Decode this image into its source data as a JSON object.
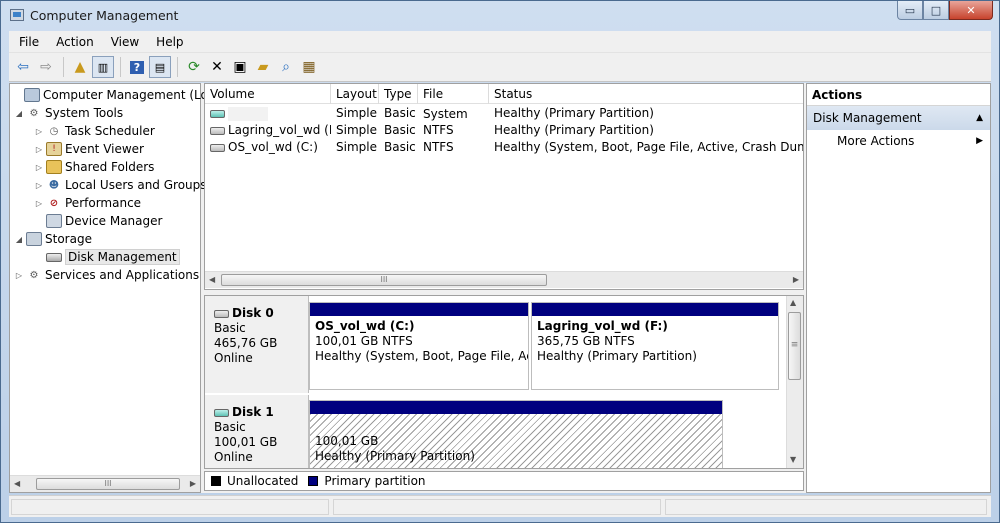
{
  "window": {
    "title": "Computer Management",
    "min": "▭",
    "max": "□",
    "close": "✕"
  },
  "menu": [
    "File",
    "Action",
    "View",
    "Help"
  ],
  "tree": [
    {
      "label": "Computer Management (Local)",
      "level": 0,
      "expander": "",
      "icon": "computer-icon"
    },
    {
      "label": "System Tools",
      "level": 1,
      "expander": "◢",
      "icon": "tools-icon"
    },
    {
      "label": "Task Scheduler",
      "level": 2,
      "expander": "▷",
      "icon": "clock-icon"
    },
    {
      "label": "Event Viewer",
      "level": 2,
      "expander": "▷",
      "icon": "event-viewer-icon"
    },
    {
      "label": "Shared Folders",
      "level": 2,
      "expander": "▷",
      "icon": "shared-folder-icon"
    },
    {
      "label": "Local Users and Groups",
      "level": 2,
      "expander": "▷",
      "icon": "users-icon"
    },
    {
      "label": "Performance",
      "level": 2,
      "expander": "▷",
      "icon": "performance-icon"
    },
    {
      "label": "Device Manager",
      "level": 2,
      "expander": "",
      "icon": "device-manager-icon"
    },
    {
      "label": "Storage",
      "level": 1,
      "expander": "◢",
      "icon": "storage-icon"
    },
    {
      "label": "Disk Management",
      "level": 2,
      "expander": "",
      "icon": "disk-management-icon"
    },
    {
      "label": "Services and Applications",
      "level": 1,
      "expander": "▷",
      "icon": "services-icon"
    }
  ],
  "volumes": {
    "headers": [
      "Volume",
      "Layout",
      "Type",
      "File System",
      "Status"
    ],
    "rows": [
      {
        "volume": "",
        "layout": "Simple",
        "type": "Basic",
        "fs": "",
        "status": "Healthy (Primary Partition)"
      },
      {
        "volume": "Lagring_vol_wd (F:)",
        "layout": "Simple",
        "type": "Basic",
        "fs": "NTFS",
        "status": "Healthy (Primary Partition)"
      },
      {
        "volume": "OS_vol_wd (C:)",
        "layout": "Simple",
        "type": "Basic",
        "fs": "NTFS",
        "status": "Healthy (System, Boot, Page File, Active, Crash Dump, Primary Partition)"
      }
    ]
  },
  "disks": [
    {
      "name": "Disk 0",
      "type": "Basic",
      "size": "465,76 GB",
      "state": "Online",
      "partitions": [
        {
          "name": "OS_vol_wd  (C:)",
          "size": "100,01 GB NTFS",
          "status": "Healthy (System, Boot, Page File, Active"
        },
        {
          "name": "Lagring_vol_wd  (F:)",
          "size": "365,75 GB NTFS",
          "status": "Healthy (Primary Partition)"
        }
      ]
    },
    {
      "name": "Disk 1",
      "type": "Basic",
      "size": "100,01 GB",
      "state": "Online",
      "partitions": [
        {
          "name": "",
          "size": "100,01 GB",
          "status": "Healthy (Primary Partition)"
        }
      ]
    }
  ],
  "legend": {
    "unallocated": "Unallocated",
    "primary": "Primary partition",
    "unallocated_color": "#000000",
    "primary_color": "#00007f"
  },
  "actions": {
    "heading": "Actions",
    "section": "Disk Management",
    "more": "More Actions"
  },
  "scroll": {
    "grip": "III",
    "vgrip": "≡",
    "left": "◀",
    "right": "▶",
    "up": "▲",
    "down": "▼"
  }
}
